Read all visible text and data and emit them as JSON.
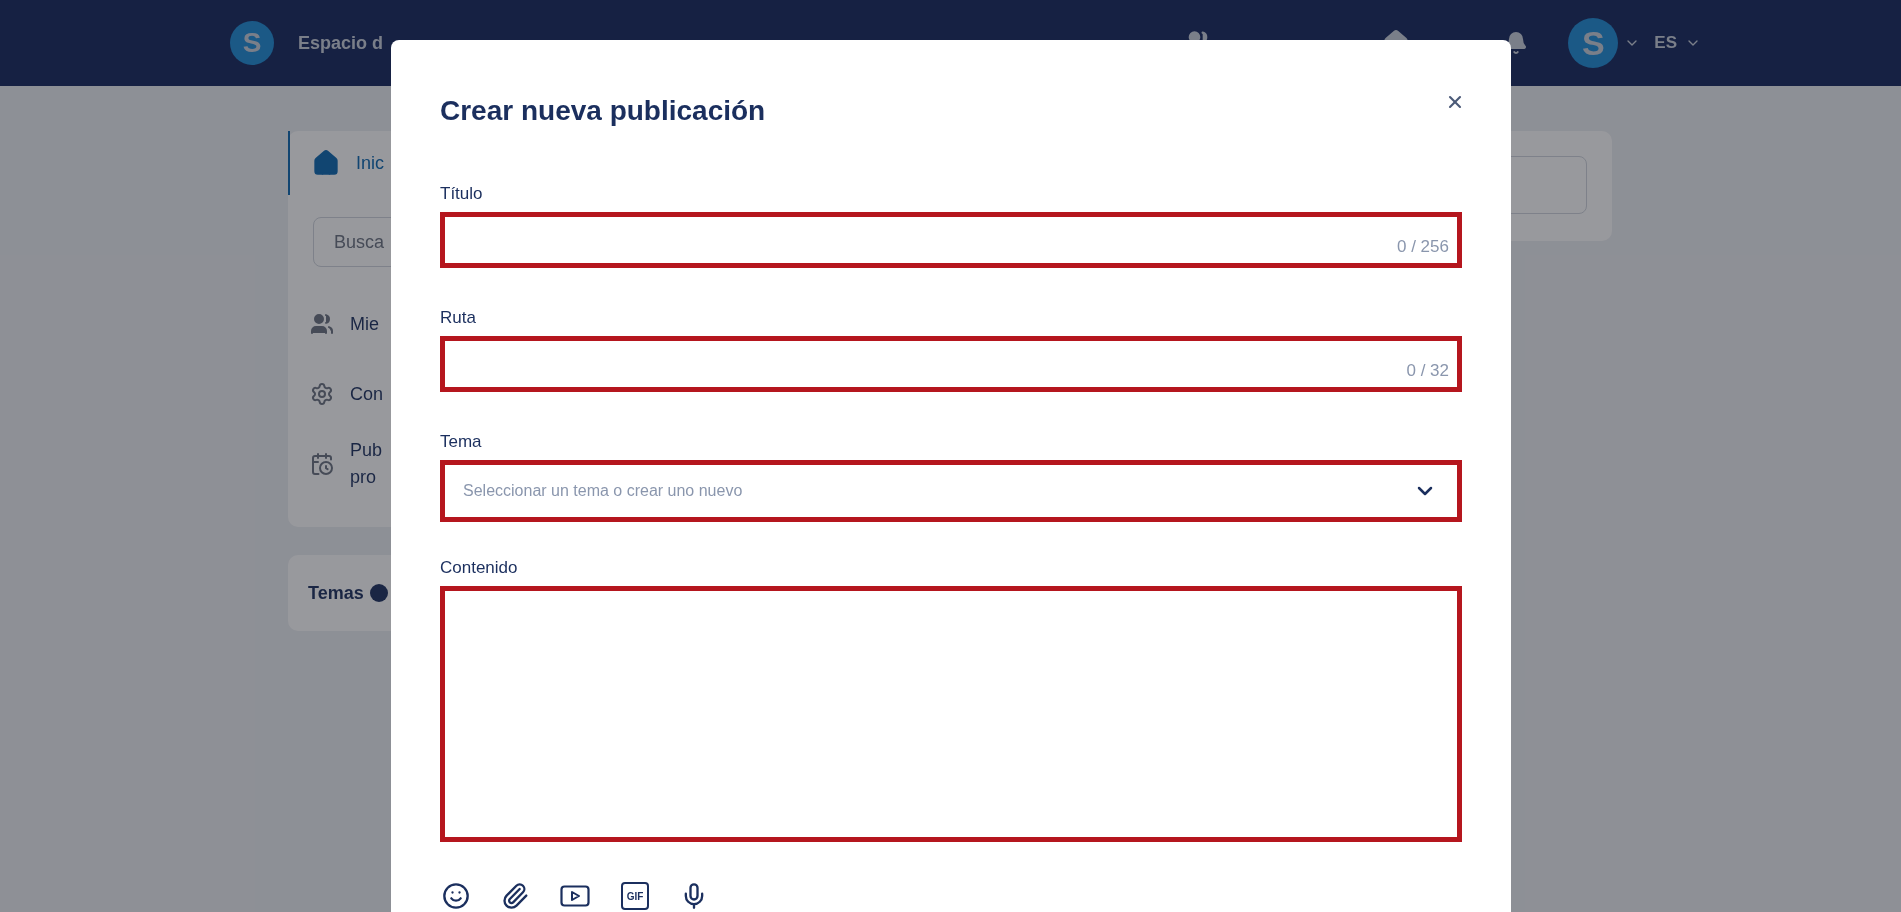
{
  "header": {
    "logo_letter": "S",
    "site_name": "Espacio d",
    "avatar_letter": "S",
    "language": "ES"
  },
  "sidebar": {
    "items": [
      {
        "kind": "home",
        "label": "Inic",
        "selected": true
      },
      {
        "kind": "search",
        "placeholder": "Busca"
      },
      {
        "kind": "members",
        "label": "Mie",
        "selected": false
      },
      {
        "kind": "settings",
        "label": "Con",
        "selected": false
      },
      {
        "kind": "scheduled",
        "label": "Pub\npro",
        "selected": false
      }
    ],
    "topics_title": "Temas"
  },
  "modal": {
    "title": "Crear nueva publicación",
    "fields": [
      {
        "kind": "text",
        "label": "Título",
        "counter": "0 / 256"
      },
      {
        "kind": "text",
        "label": "Ruta",
        "counter": "0 / 32"
      },
      {
        "kind": "select",
        "label": "Tema",
        "placeholder": "Seleccionar un tema o crear uno nuevo"
      },
      {
        "kind": "textarea",
        "label": "Contenido"
      }
    ],
    "toolbar": [
      {
        "kind": "emoji"
      },
      {
        "kind": "attach"
      },
      {
        "kind": "video"
      },
      {
        "kind": "gif",
        "label": "GIF"
      },
      {
        "kind": "mic"
      }
    ]
  }
}
